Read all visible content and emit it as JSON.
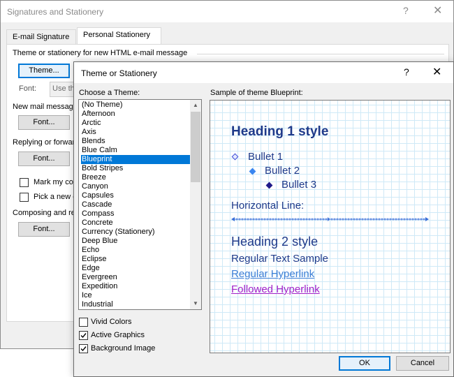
{
  "outer": {
    "title": "Signatures and Stationery",
    "help": "?",
    "close": "✕",
    "tabs": [
      "E-mail Signature",
      "Personal Stationery"
    ],
    "section_theme": "Theme or stationery for new HTML e-mail message",
    "theme_button": "Theme...",
    "font_label": "Font:",
    "font_value": "Use theme",
    "section_new_mail": "New mail messages",
    "section_replying": "Replying or forwarding",
    "mark_comments": "Mark my comments",
    "pick_color": "Pick a new color",
    "section_composing": "Composing and reading",
    "font_button": "Font..."
  },
  "inner": {
    "title": "Theme or Stationery",
    "help": "?",
    "close": "✕",
    "choose_label": "Choose a Theme:",
    "sample_label": "Sample of theme Blueprint:",
    "themes": [
      "(No Theme)",
      "Afternoon",
      "Arctic",
      "Axis",
      "Blends",
      "Blue Calm",
      "Blueprint",
      "Bold Stripes",
      "Breeze",
      "Canyon",
      "Capsules",
      "Cascade",
      "Compass",
      "Concrete",
      "Currency (Stationery)",
      "Deep Blue",
      "Echo",
      "Eclipse",
      "Edge",
      "Evergreen",
      "Expedition",
      "Ice",
      "Industrial"
    ],
    "selected_theme": "Blueprint",
    "vivid_colors": "Vivid Colors",
    "active_graphics": "Active Graphics",
    "background_image": "Background Image",
    "checkbox_state": {
      "vivid_colors": false,
      "active_graphics": true,
      "background_image": true
    },
    "ok_button": "OK",
    "cancel_button": "Cancel"
  },
  "sample": {
    "heading1": "Heading 1 style",
    "bullet1": "Bullet 1",
    "bullet2": "Bullet 2",
    "bullet3": "Bullet 3",
    "hr_label": "Horizontal Line:",
    "heading2": "Heading 2 style",
    "regular_text": "Regular Text Sample",
    "hyperlink": "Regular Hyperlink",
    "followed_hyperlink": "Followed Hyperlink"
  },
  "colors": {
    "accent": "#0078d7",
    "sample_text": "#1f3a8a",
    "hyperlink": "#3d7fd6",
    "followed": "#a020c8",
    "bullet1": "#3f4fd8",
    "bullet2": "#3a86f0",
    "bullet3": "#1f1a8a",
    "grid": "#cfe9f7"
  }
}
